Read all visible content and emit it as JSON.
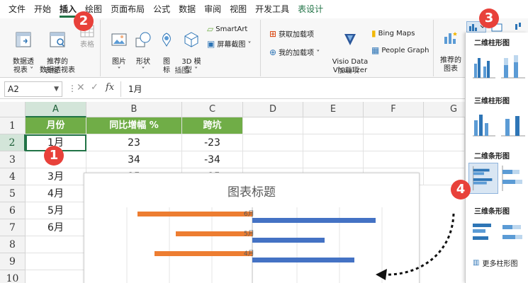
{
  "menu": {
    "tabs": [
      {
        "label": "文件"
      },
      {
        "label": "开始"
      },
      {
        "label": "插入"
      },
      {
        "label": "绘图"
      },
      {
        "label": "页面布局"
      },
      {
        "label": "公式"
      },
      {
        "label": "数据"
      },
      {
        "label": "审阅"
      },
      {
        "label": "视图"
      },
      {
        "label": "开发工具"
      },
      {
        "label": "表设计"
      }
    ]
  },
  "ribbon": {
    "tables": {
      "label": "表格",
      "pivot": "数据透\n视表 ˅",
      "recommended_pivot": "推荐的\n数据透视表",
      "table": "表格"
    },
    "illustrations": {
      "label": "插图",
      "pictures": "图片\n˅",
      "shapes": "形状\n˅",
      "icons": "图\n标",
      "model3d": "3D 模\n型 ˅",
      "smartart": "SmartArt",
      "screenshot": "屏幕截图 ˅"
    },
    "addins": {
      "label": "加载项",
      "get_addins": "获取加载项",
      "my_addins": "我的加载项 ˅",
      "visio": "Visio Data\nVisualizer",
      "bing": "Bing Maps",
      "people": "People Graph"
    },
    "charts": {
      "recommended": "推荐的\n图表"
    }
  },
  "formula_bar": {
    "name_box": "A2",
    "cancel": "✕",
    "enter": "✓",
    "fx": "fx",
    "value": "1月"
  },
  "sheet": {
    "columns": [
      "A",
      "B",
      "C",
      "D",
      "E",
      "F",
      "G"
    ],
    "rows": [
      "1",
      "2",
      "3",
      "4",
      "5",
      "6",
      "7",
      "8",
      "9",
      "10"
    ],
    "header": [
      "月份",
      "同比增幅 %",
      "跨坑"
    ],
    "data": [
      [
        "1月",
        "23",
        "-23"
      ],
      [
        "",
        "34",
        "-34"
      ],
      [
        "3月",
        "15",
        "-15"
      ],
      [
        "4月",
        "",
        ""
      ],
      [
        "5月",
        "",
        ""
      ],
      [
        "6月",
        "",
        ""
      ]
    ]
  },
  "chart": {
    "title": "图表标题"
  },
  "chart_data": {
    "type": "bar",
    "orientation": "horizontal",
    "title": "图表标题",
    "categories": [
      "6月",
      "5月",
      "4月"
    ],
    "series": [
      {
        "values": [
          -27,
          -18,
          -23
        ]
      },
      {
        "values": [
          29,
          17,
          24
        ]
      }
    ],
    "visible_category_labels": [
      "6月",
      "5月",
      "4月"
    ],
    "colors": [
      "#ed7d31",
      "#4472c4"
    ]
  },
  "panel": {
    "section_2d_column": "二维柱形图",
    "section_3d_column": "三维柱形图",
    "section_2d_bar": "二维条形图",
    "section_3d_bar": "三维条形图",
    "more": "更多柱形图"
  },
  "badges": [
    "1",
    "2",
    "3",
    "4"
  ],
  "colors": {
    "excel_green": "#217346",
    "header_fill": "#70ad47",
    "badge_red": "#e8413a",
    "series_orange": "#ed7d31",
    "series_blue": "#4472c4"
  }
}
